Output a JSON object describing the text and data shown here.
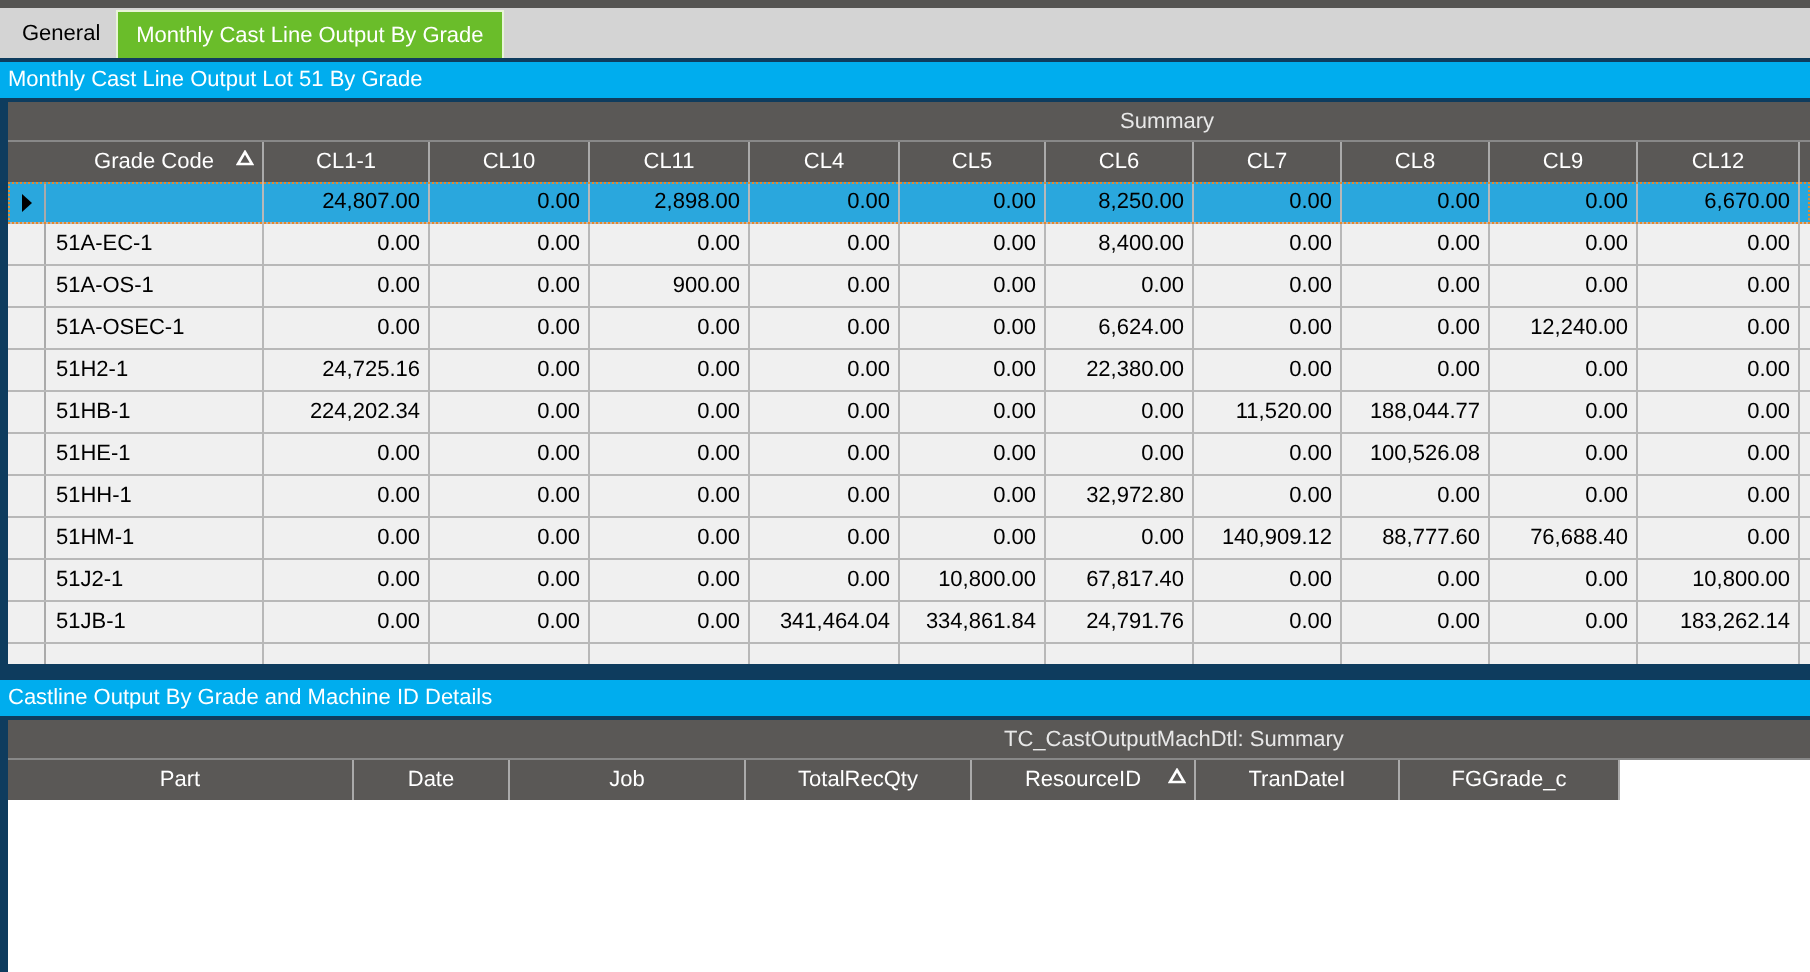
{
  "tabs": [
    {
      "label": "General",
      "selected": false
    },
    {
      "label": "Monthly Cast Line Output By Grade",
      "selected": true
    }
  ],
  "top_panel": {
    "title": "Monthly Cast Line Output Lot 51 By Grade",
    "band": "Summary",
    "columns": [
      {
        "label": "Grade Code",
        "sorted": true
      },
      {
        "label": "CL1-1",
        "sorted": false
      },
      {
        "label": "CL10",
        "sorted": false
      },
      {
        "label": "CL11",
        "sorted": false
      },
      {
        "label": "CL4",
        "sorted": false
      },
      {
        "label": "CL5",
        "sorted": false
      },
      {
        "label": "CL6",
        "sorted": false
      },
      {
        "label": "CL7",
        "sorted": false
      },
      {
        "label": "CL8",
        "sorted": false
      },
      {
        "label": "CL9",
        "sorted": false
      },
      {
        "label": "CL12",
        "sorted": false
      }
    ],
    "rows": [
      {
        "selected": true,
        "cells": [
          "",
          "24,807.00",
          "0.00",
          "2,898.00",
          "0.00",
          "0.00",
          "8,250.00",
          "0.00",
          "0.00",
          "0.00",
          "6,670.00"
        ]
      },
      {
        "selected": false,
        "cells": [
          "51A-EC-1",
          "0.00",
          "0.00",
          "0.00",
          "0.00",
          "0.00",
          "8,400.00",
          "0.00",
          "0.00",
          "0.00",
          "0.00"
        ]
      },
      {
        "selected": false,
        "cells": [
          "51A-OS-1",
          "0.00",
          "0.00",
          "900.00",
          "0.00",
          "0.00",
          "0.00",
          "0.00",
          "0.00",
          "0.00",
          "0.00"
        ]
      },
      {
        "selected": false,
        "cells": [
          "51A-OSEC-1",
          "0.00",
          "0.00",
          "0.00",
          "0.00",
          "0.00",
          "6,624.00",
          "0.00",
          "0.00",
          "12,240.00",
          "0.00"
        ]
      },
      {
        "selected": false,
        "cells": [
          "51H2-1",
          "24,725.16",
          "0.00",
          "0.00",
          "0.00",
          "0.00",
          "22,380.00",
          "0.00",
          "0.00",
          "0.00",
          "0.00"
        ]
      },
      {
        "selected": false,
        "cells": [
          "51HB-1",
          "224,202.34",
          "0.00",
          "0.00",
          "0.00",
          "0.00",
          "0.00",
          "11,520.00",
          "188,044.77",
          "0.00",
          "0.00"
        ]
      },
      {
        "selected": false,
        "cells": [
          "51HE-1",
          "0.00",
          "0.00",
          "0.00",
          "0.00",
          "0.00",
          "0.00",
          "0.00",
          "100,526.08",
          "0.00",
          "0.00"
        ]
      },
      {
        "selected": false,
        "cells": [
          "51HH-1",
          "0.00",
          "0.00",
          "0.00",
          "0.00",
          "0.00",
          "32,972.80",
          "0.00",
          "0.00",
          "0.00",
          "0.00"
        ]
      },
      {
        "selected": false,
        "cells": [
          "51HM-1",
          "0.00",
          "0.00",
          "0.00",
          "0.00",
          "0.00",
          "0.00",
          "140,909.12",
          "88,777.60",
          "76,688.40",
          "0.00"
        ]
      },
      {
        "selected": false,
        "cells": [
          "51J2-1",
          "0.00",
          "0.00",
          "0.00",
          "0.00",
          "10,800.00",
          "67,817.40",
          "0.00",
          "0.00",
          "0.00",
          "10,800.00"
        ]
      },
      {
        "selected": false,
        "cells": [
          "51JB-1",
          "0.00",
          "0.00",
          "0.00",
          "341,464.04",
          "334,861.84",
          "24,791.76",
          "0.00",
          "0.00",
          "0.00",
          "183,262.14"
        ]
      }
    ]
  },
  "bottom_panel": {
    "title": "Castline Output By Grade and Machine ID Details",
    "band": "TC_CastOutputMachDtl: Summary",
    "columns": [
      {
        "label": "Part",
        "sorted": false
      },
      {
        "label": "Date",
        "sorted": false
      },
      {
        "label": "Job",
        "sorted": false
      },
      {
        "label": "TotalRecQty",
        "sorted": false
      },
      {
        "label": "ResourceID",
        "sorted": true
      },
      {
        "label": "TranDateI",
        "sorted": false
      },
      {
        "label": "FGGrade_c",
        "sorted": false
      }
    ]
  }
}
